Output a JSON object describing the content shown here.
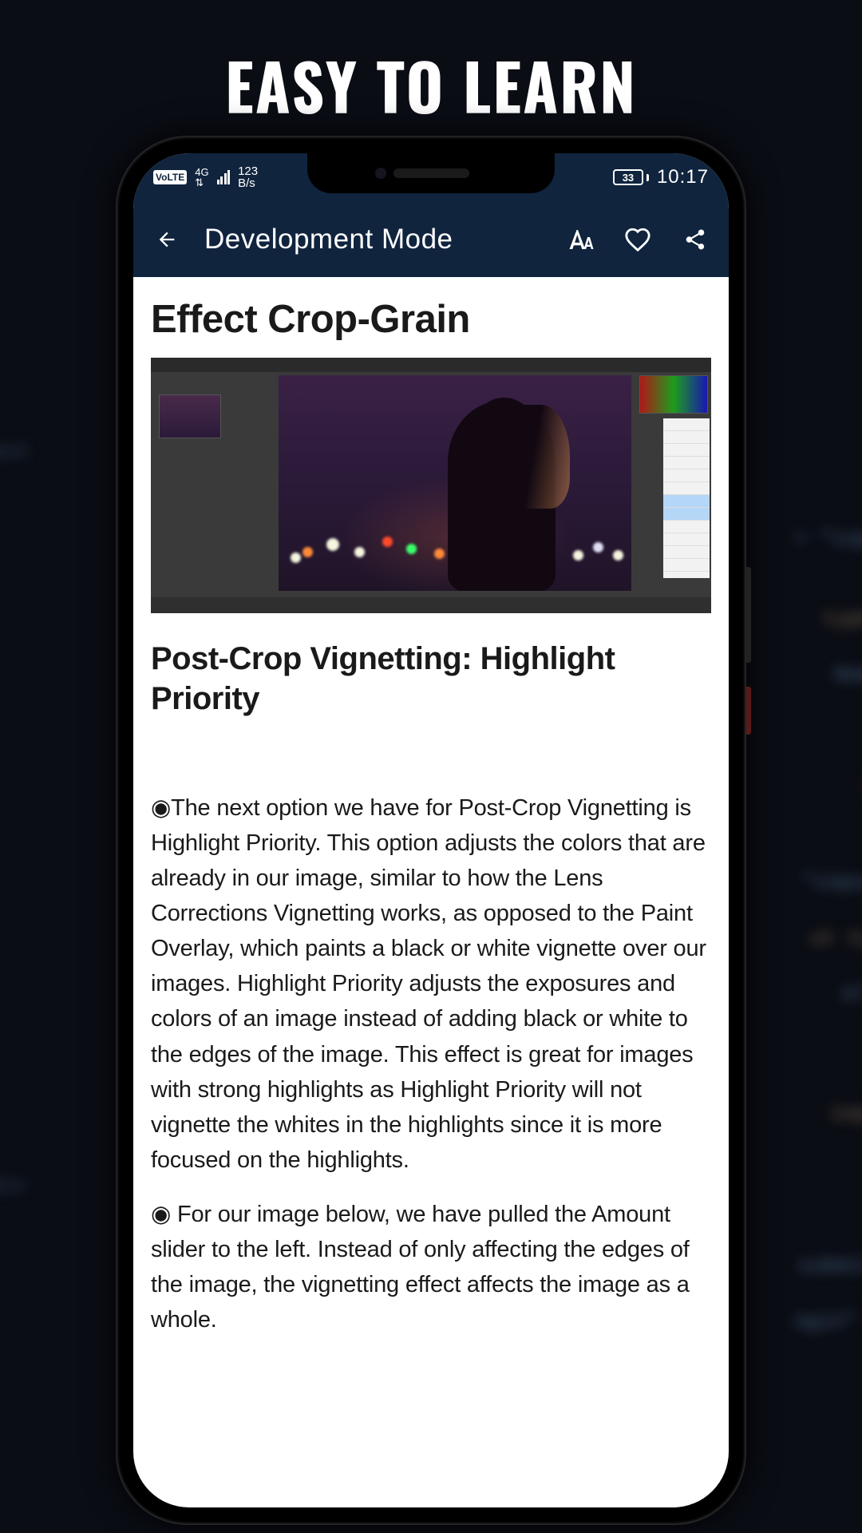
{
  "headline": "EASY TO LEARN",
  "statusbar": {
    "volte": "VoLTE",
    "net_gen": "4G",
    "speed_top": "123",
    "speed_bottom": "B/s",
    "battery": "33",
    "time": "10:17"
  },
  "appbar": {
    "title": "Development Mode"
  },
  "article": {
    "h1": "Effect Crop-Grain",
    "h2": "Post-Crop Vignetting: Highlight Priority",
    "p1": "◉The next option we have for Post-Crop Vignetting is Highlight Priority. This option adjusts the colors that are already in our image, similar to how the Lens Corrections Vignetting works, as opposed to the Paint Overlay, which paints a black or white vignette over our images. Highlight Priority adjusts the exposures and colors of an image instead of adding black or white to the edges of the image. This effect is great for images with strong highlights as Highlight Priority will not vignette the whites in the highlights since it is more focused on the highlights.",
    "p2": "◉ For our image below, we have pulled the Amount slider to the left. Instead of only affecting the edges of the image, the vignetting effect affects the image as a whole."
  },
  "bg_words": [
    "inputBox",
    "type=\"p",
    "Nombre",
    "Contrase",
    "submit\"",
    "login\"",
    "Corre",
    "type-"
  ]
}
